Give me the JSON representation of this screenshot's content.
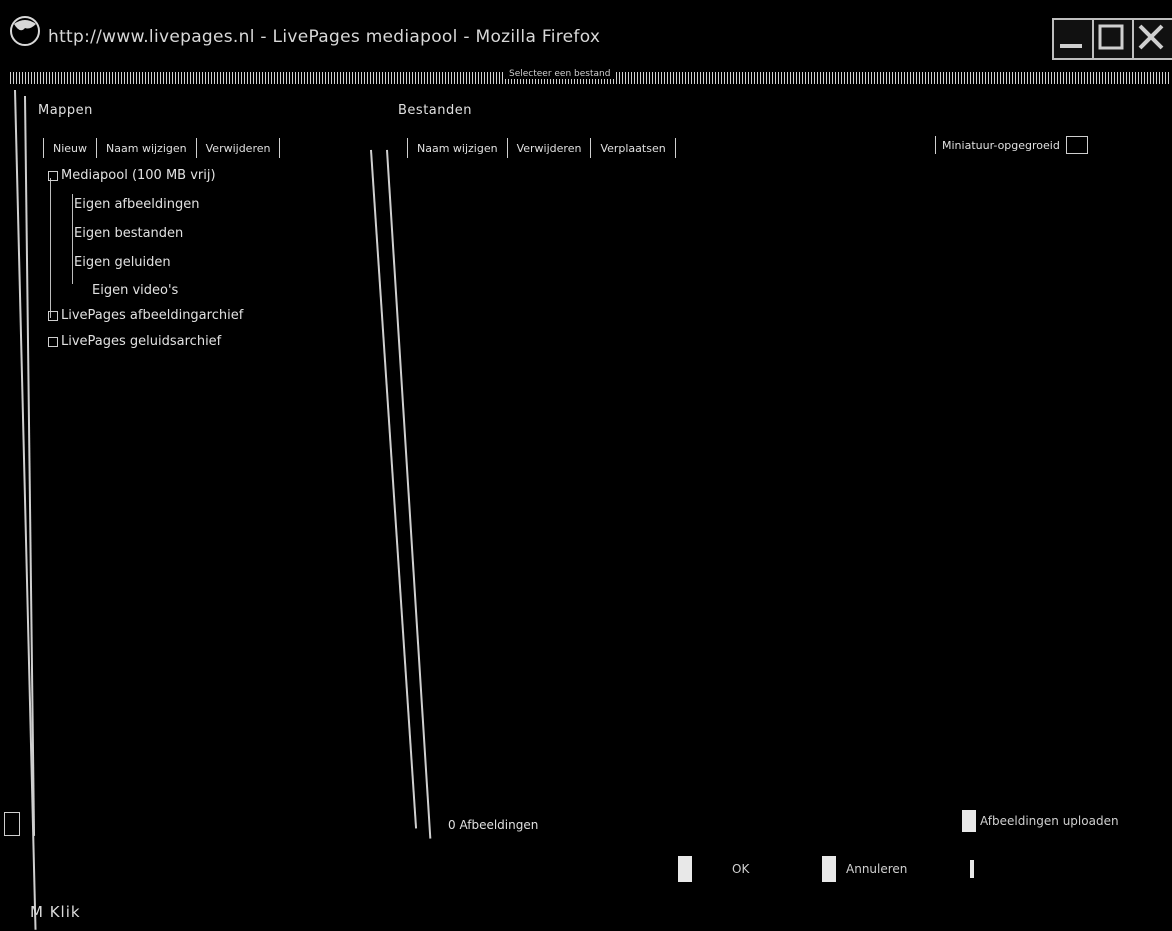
{
  "window": {
    "title": "http://www.livepages.nl - LivePages mediapool - Mozilla Firefox",
    "strip_label": "Selecteer een bestand"
  },
  "folders": {
    "heading": "Mappen",
    "toolbar": [
      "Nieuw",
      "Naam wijzigen",
      "Verwijderen"
    ]
  },
  "files": {
    "heading": "Bestanden",
    "toolbar": [
      "Naam wijzigen",
      "Verwijderen",
      "Verplaatsen"
    ],
    "slider_label": "Miniatuur-opgegroeid",
    "count_label": "0 Afbeeldingen",
    "upload_label": "Afbeeldingen uploaden"
  },
  "tree": {
    "root": "Mediapool (100 MB vrij)",
    "children": [
      "Eigen afbeeldingen",
      "Eigen bestanden",
      "Eigen geluiden",
      "Eigen video's"
    ],
    "archives": [
      "LivePages afbeeldingarchief",
      "LivePages geluidsarchief"
    ]
  },
  "dialog": {
    "ok_label": "OK",
    "cancel_label": "Annuleren"
  },
  "footer": {
    "logo_text": "M Klik"
  }
}
